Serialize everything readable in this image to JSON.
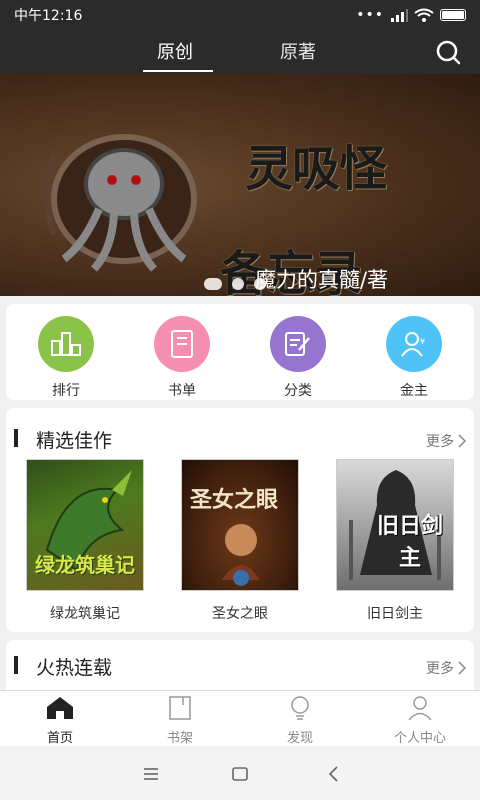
{
  "status_bar": {
    "time": "中午12:16",
    "network": "4G"
  },
  "top_nav": {
    "tabs": [
      "原创",
      "原著"
    ],
    "active_tab": 0
  },
  "banner": {
    "title_line1": "灵吸怪",
    "title_line2": "备忘录",
    "author": "魔力的真髓/著",
    "slides": 3,
    "active_slide": 0
  },
  "categories": [
    {
      "label": "排行",
      "icon": "ranking-icon",
      "color": "#8bc34a"
    },
    {
      "label": "书单",
      "icon": "booklist-icon",
      "color": "#f48fb1"
    },
    {
      "label": "分类",
      "icon": "category-icon",
      "color": "#9575cd"
    },
    {
      "label": "金主",
      "icon": "patron-icon",
      "color": "#4fc3f7"
    }
  ],
  "featured": {
    "title": "精选佳作",
    "more": "更多",
    "books": [
      {
        "title": "绿龙筑巢记"
      },
      {
        "title": "圣女之眼"
      },
      {
        "title": "旧日剑主"
      }
    ]
  },
  "hot": {
    "title": "火热连载",
    "more": "更多"
  },
  "tab_bar": {
    "items": [
      "首页",
      "书架",
      "发现",
      "个人中心"
    ],
    "active": 0
  }
}
